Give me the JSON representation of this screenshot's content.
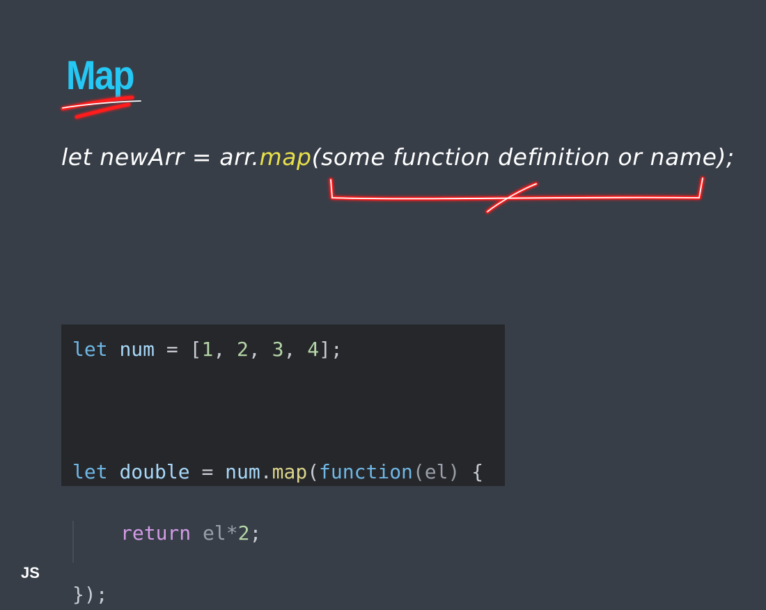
{
  "slide": {
    "title": "Map",
    "syntax": {
      "prefix": "let newArr = arr.",
      "method": "map",
      "suffix": "(some function definition or name);"
    },
    "footer_label": "JS"
  },
  "code": {
    "line1": {
      "kw": "let",
      "var": "num",
      "eq": "=",
      "open": "[",
      "n1": "1",
      "n2": "2",
      "n3": "3",
      "n4": "4",
      "close": "];"
    },
    "line3": {
      "kw": "let",
      "var": "double",
      "eq": "=",
      "obj": "num",
      "dot": ".",
      "method": "map",
      "paren": "(",
      "fnkw": "function",
      "param": "(el)",
      "brace": "{"
    },
    "line4": {
      "ret": "return",
      "expr": "el*",
      "num": "2",
      "end": ";"
    },
    "line5": {
      "end": "});"
    }
  },
  "colors": {
    "background": "#373e48",
    "title": "#25c8f4",
    "highlight": "#e8e04a",
    "annotation": "#ff1a1a",
    "code_background": "#26272b"
  }
}
